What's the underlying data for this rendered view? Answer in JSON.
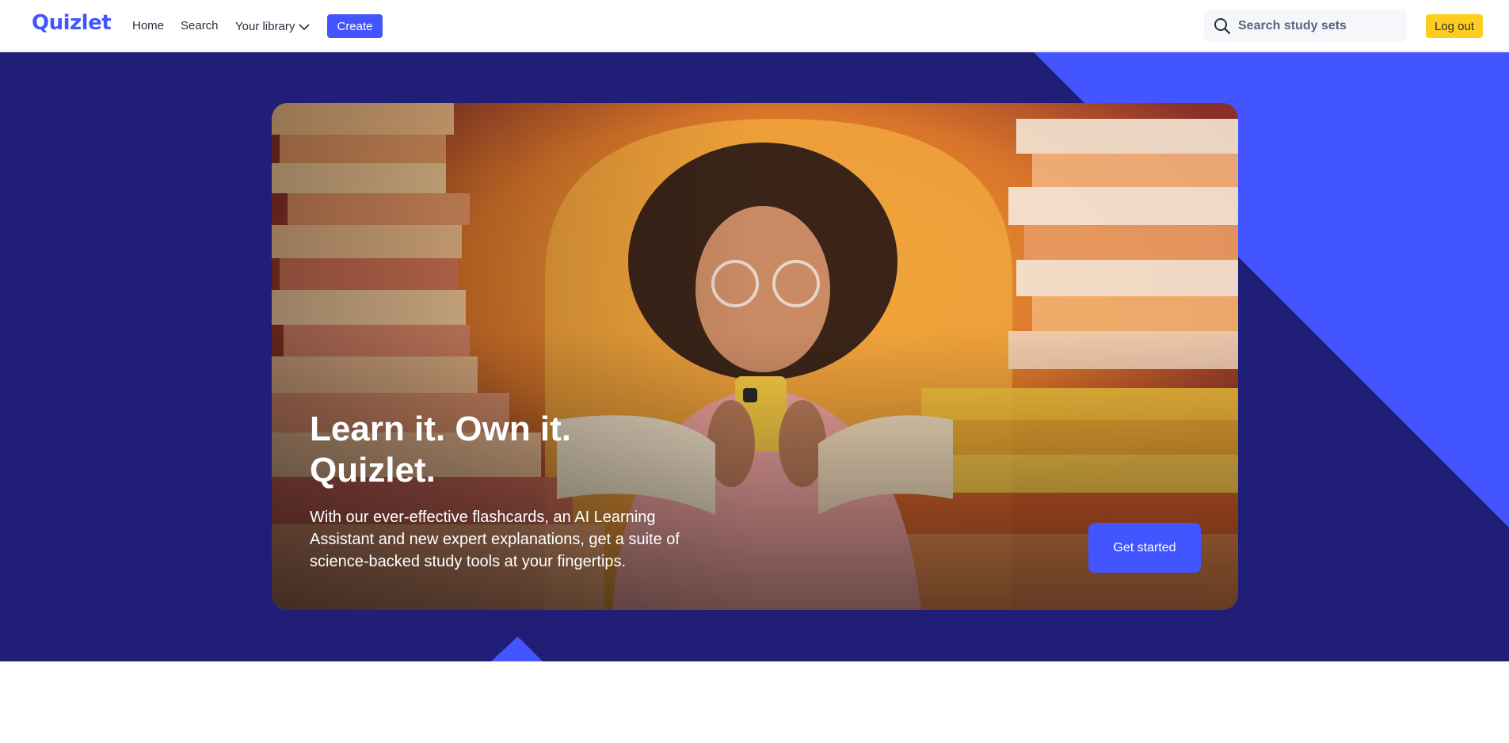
{
  "header": {
    "logo": "Quizlet",
    "nav": {
      "home": "Home",
      "search": "Search",
      "library": "Your library"
    },
    "create_label": "Create",
    "search": {
      "placeholder": "Search study sets"
    },
    "logout_label": "Log out"
  },
  "hero": {
    "title_line1": "Learn it. Own it.",
    "title_line2": "Quizlet.",
    "description": "With our ever-effective flashcards, an AI Learning Assistant and new expert explanations, get a suite of science-backed study tools at your fingertips.",
    "cta_label": "Get started"
  },
  "colors": {
    "brand": "#4255ff",
    "navy": "#211e78",
    "logout": "#ffcd1f"
  },
  "icons": {
    "search": "search-icon",
    "chevron": "chevron-down-icon"
  }
}
